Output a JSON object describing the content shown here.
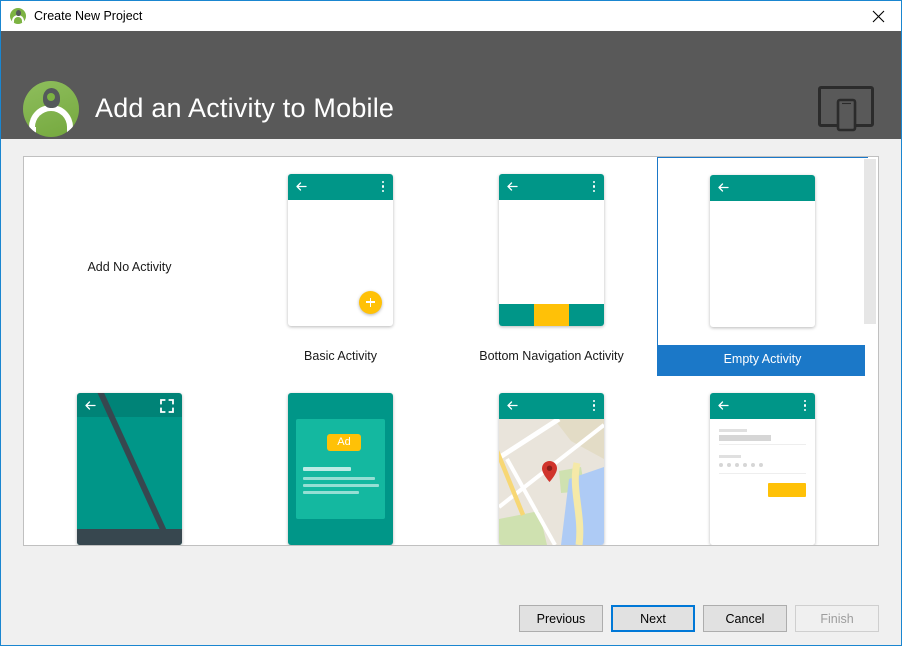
{
  "window": {
    "title": "Create New Project",
    "close_icon": "close-icon",
    "app_icon": "android-studio-logo-icon"
  },
  "header": {
    "title": "Add an Activity to Mobile",
    "logo_icon": "android-studio-logo-icon",
    "device_icon": "tablet-and-phone-icon",
    "background_color": "#595959"
  },
  "colors": {
    "teal": "#009688",
    "teal_light": "#14b8a0",
    "amber": "#ffc107",
    "selection_blue": "#1b78c8",
    "focus_blue": "#0078d7"
  },
  "activities": [
    {
      "label": "Add No Activity",
      "thumbnail": "none",
      "selected": false
    },
    {
      "label": "Basic Activity",
      "thumbnail": "basic-activity-thumbnail",
      "selected": false
    },
    {
      "label": "Bottom Navigation Activity",
      "thumbnail": "bottom-navigation-activity-thumbnail",
      "selected": false
    },
    {
      "label": "Empty Activity",
      "thumbnail": "empty-activity-thumbnail",
      "selected": true
    },
    {
      "label": "",
      "thumbnail": "fullscreen-activity-thumbnail",
      "selected": false
    },
    {
      "label": "",
      "thumbnail": "ads-activity-thumbnail",
      "selected": false
    },
    {
      "label": "",
      "thumbnail": "google-maps-activity-thumbnail",
      "selected": false
    },
    {
      "label": "",
      "thumbnail": "login-activity-thumbnail",
      "selected": false
    }
  ],
  "thumbnails": {
    "ad_badge_text": "Ad"
  },
  "footer": {
    "buttons": [
      {
        "label": "Previous",
        "state": "enabled"
      },
      {
        "label": "Next",
        "state": "focused"
      },
      {
        "label": "Cancel",
        "state": "enabled"
      },
      {
        "label": "Finish",
        "state": "disabled"
      }
    ]
  }
}
